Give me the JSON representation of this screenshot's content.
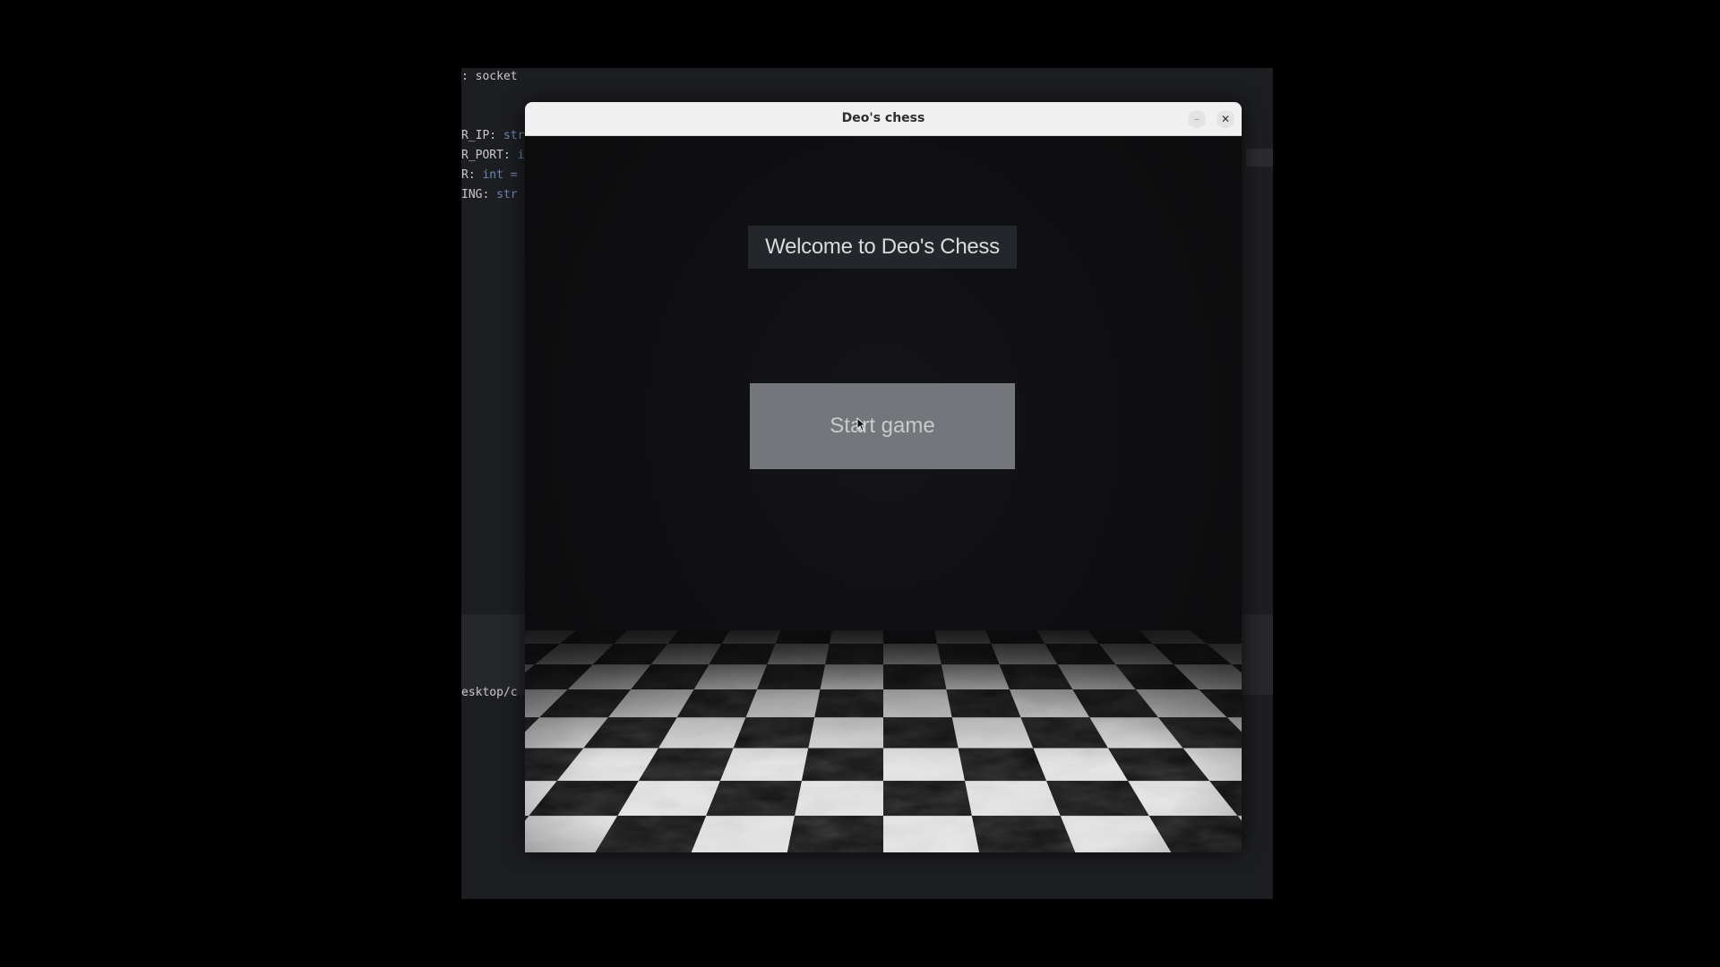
{
  "editor": {
    "lines": [
      [
        {
          "t": ": socket",
          "c": ""
        }
      ],
      [
        {
          "t": "R_IP: ",
          "c": ""
        },
        {
          "t": "str",
          "c": "type"
        }
      ],
      [
        {
          "t": "R_PORT: ",
          "c": ""
        },
        {
          "t": "in",
          "c": "type"
        }
      ],
      [
        {
          "t": "R: ",
          "c": ""
        },
        {
          "t": "int =",
          "c": "type"
        }
      ],
      [
        {
          "t": "ING: ",
          "c": ""
        },
        {
          "t": "str",
          "c": "type"
        }
      ]
    ],
    "terminal_text": "esktop/c"
  },
  "window": {
    "title": "Deo's chess",
    "minimize_symbol": "–",
    "close_symbol": "✕"
  },
  "game": {
    "welcome_text": "Welcome to Deo's Chess",
    "start_button_label": "Start game"
  },
  "icons": {
    "cursor": "mouse-pointer-icon",
    "close": "close-icon",
    "minimize": "minimize-icon"
  },
  "colors": {
    "background": "#000000",
    "window_bg": "#0b0b0d",
    "titlebar": "#f1f0f0",
    "label_bg": "#23272c",
    "button_bg": "#73777b",
    "tile_light": "#e6e6e6",
    "tile_dark": "#111111"
  }
}
